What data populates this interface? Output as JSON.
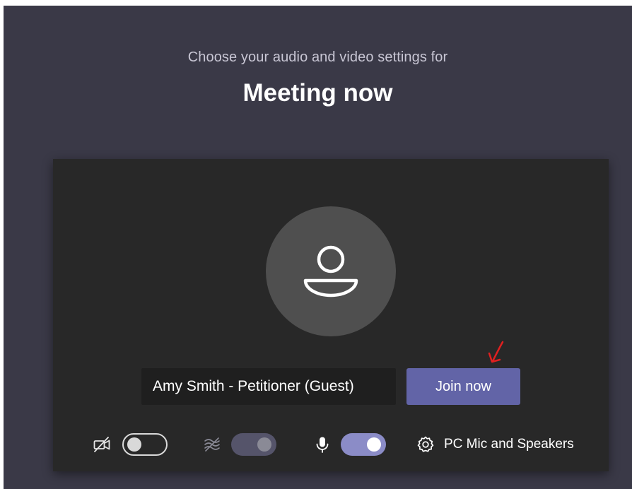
{
  "header": {
    "subtitle": "Choose your audio and video settings for",
    "title": "Meeting now"
  },
  "prejoin": {
    "display_name": "Amy Smith - Petitioner (Guest)",
    "join_button_label": "Join now"
  },
  "controls": {
    "camera_toggle": "off",
    "background_blur_toggle": "disabled-on",
    "microphone_toggle": "on",
    "device_settings_label": "PC Mic and Speakers"
  },
  "icons": {
    "avatar": "person-icon",
    "camera": "camera-off-icon",
    "background": "background-blur-icon",
    "microphone": "microphone-icon",
    "settings": "gear-icon",
    "annotation": "red-arrow-icon"
  },
  "colors": {
    "page_background": "#3a3947",
    "panel_background": "#282828",
    "join_button": "#6264a7",
    "toggle_on": "#8b8cc7",
    "annotation": "#e02020"
  }
}
